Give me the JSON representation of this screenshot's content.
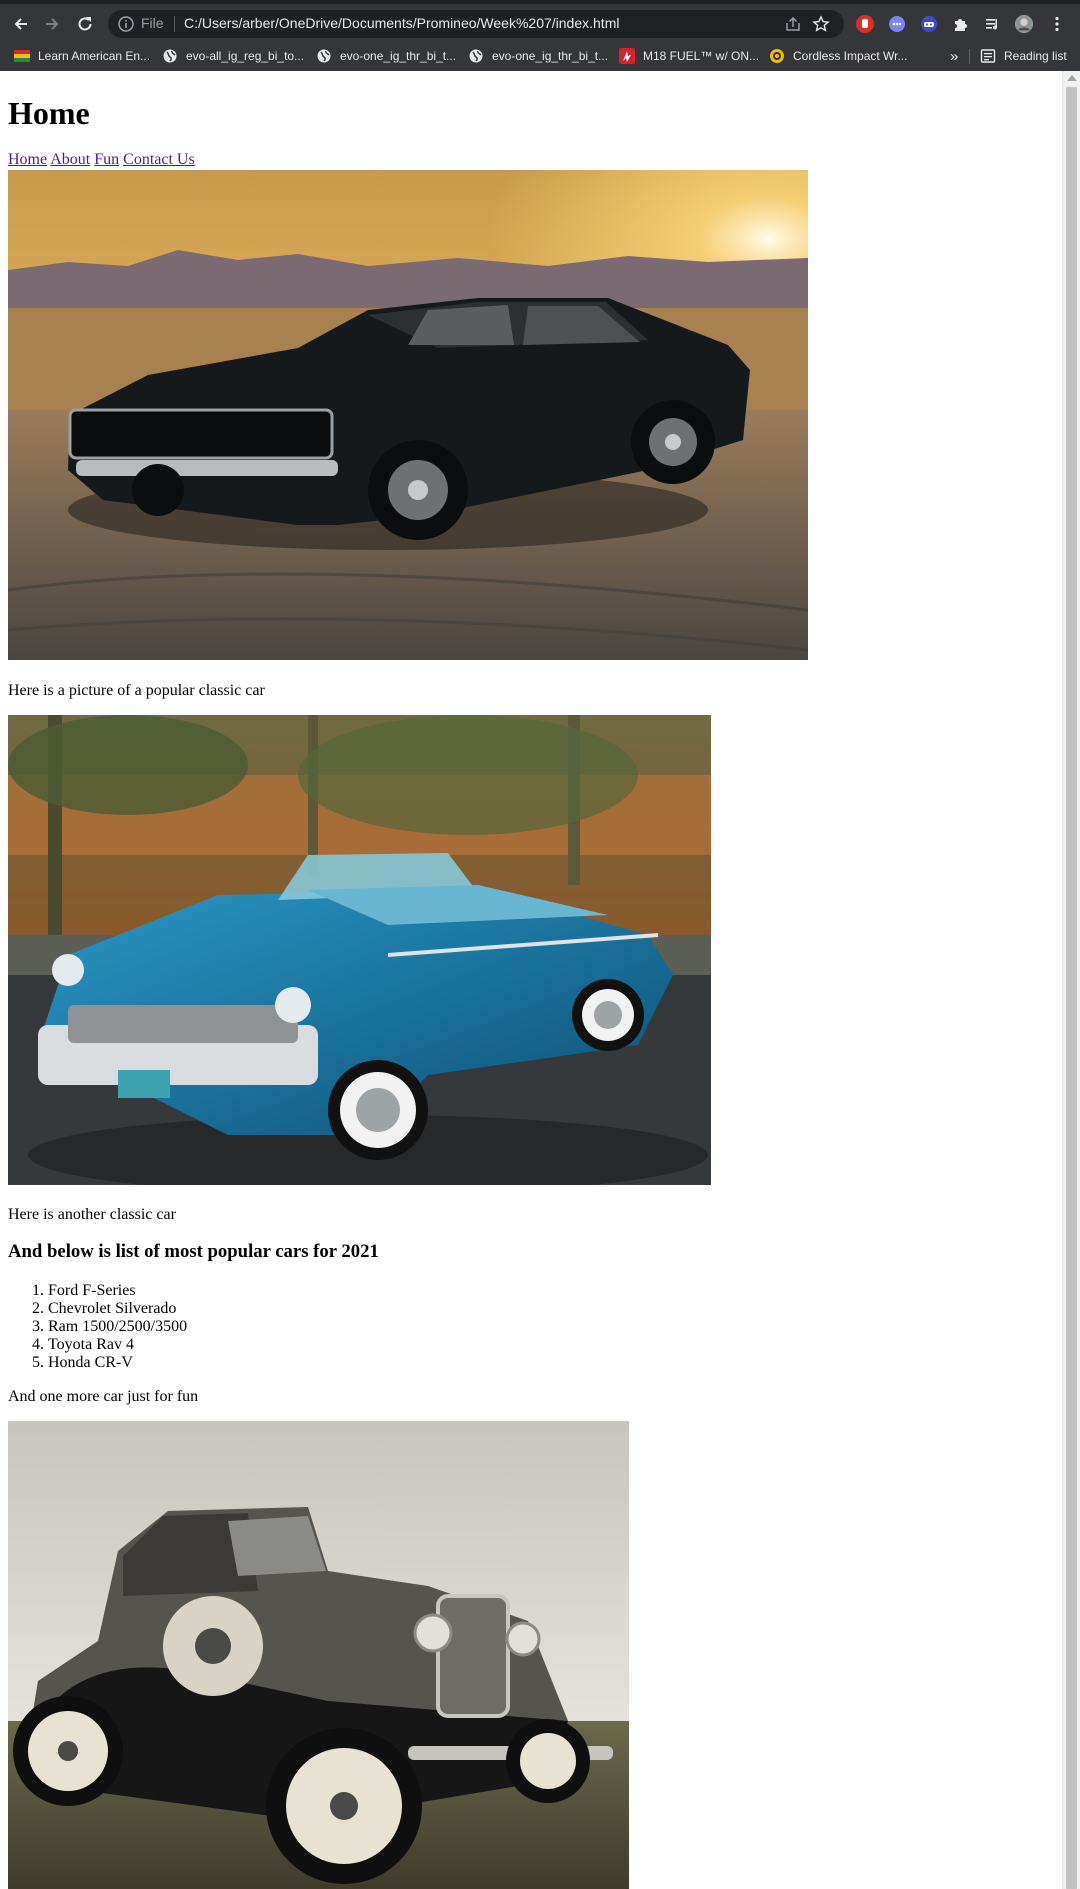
{
  "browser": {
    "omnibox": {
      "scheme_label": "File",
      "url": "C:/Users/arber/OneDrive/Documents/Promineo/Week%207/index.html"
    },
    "bookmarks": [
      {
        "label": "Learn American En...",
        "icon": "flag-icon"
      },
      {
        "label": "evo-all_ig_reg_bi_to...",
        "icon": "globe-icon"
      },
      {
        "label": "evo-one_ig_thr_bi_t...",
        "icon": "globe-icon"
      },
      {
        "label": "evo-one_ig_thr_bi_t...",
        "icon": "globe-icon"
      },
      {
        "label": "M18 FUEL™ w/ ON...",
        "icon": "milwaukee-icon"
      },
      {
        "label": "Cordless Impact Wr...",
        "icon": "tool-brand-icon"
      }
    ],
    "overflow_label": "»",
    "reading_list_label": "Reading list"
  },
  "page": {
    "title": "Home",
    "nav": [
      "Home",
      "About",
      "Fun",
      "Contact Us"
    ],
    "images": [
      {
        "alt": "black classic muscle car at sunset"
      },
      {
        "alt": "blue classic convertible"
      },
      {
        "alt": "vintage antique car"
      }
    ],
    "caption1": "Here is a picture of a popular classic car",
    "caption2": "Here is another classic car",
    "list_heading": "And below is list of most popular cars for 2021",
    "list": [
      "Ford F-Series",
      "Chevrolet Silverado",
      "Ram 1500/2500/3500",
      "Toyota Rav 4",
      "Honda CR-V"
    ],
    "caption3": "And one more car just for fun"
  }
}
